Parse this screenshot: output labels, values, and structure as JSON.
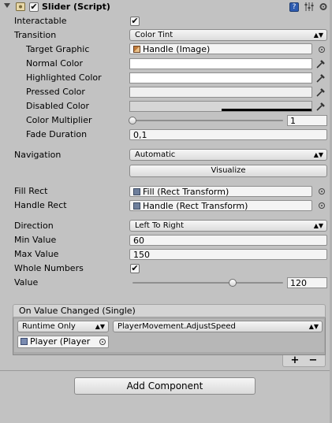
{
  "header": {
    "component_title": "Slider (Script)",
    "enabled": true
  },
  "props": {
    "interactable": {
      "label": "Interactable",
      "checked": true
    },
    "transition": {
      "label": "Transition",
      "value": "Color Tint"
    },
    "target_graphic": {
      "label": "Target Graphic",
      "value": "Handle (Image)"
    },
    "normal_color": {
      "label": "Normal Color",
      "color": "#ffffff"
    },
    "highlighted_color": {
      "label": "Highlighted Color",
      "color": "#ffffff"
    },
    "pressed_color": {
      "label": "Pressed Color",
      "color": "#c8c8c8"
    },
    "disabled_color": {
      "label": "Disabled Color",
      "color": "#c8c8c8"
    },
    "color_multiplier": {
      "label": "Color Multiplier",
      "value": "1",
      "fraction": 0.0
    },
    "fade_duration": {
      "label": "Fade Duration",
      "value": "0,1"
    },
    "navigation": {
      "label": "Navigation",
      "value": "Automatic",
      "visualize": "Visualize"
    },
    "fill_rect": {
      "label": "Fill Rect",
      "value": "Fill (Rect Transform)"
    },
    "handle_rect": {
      "label": "Handle Rect",
      "value": "Handle (Rect Transform)"
    },
    "direction": {
      "label": "Direction",
      "value": "Left To Right"
    },
    "min_value": {
      "label": "Min Value",
      "value": "60"
    },
    "max_value": {
      "label": "Max Value",
      "value": "150"
    },
    "whole_numbers": {
      "label": "Whole Numbers",
      "checked": true
    },
    "value": {
      "label": "Value",
      "value": "120",
      "fraction": 0.6667
    }
  },
  "event": {
    "title": "On Value Changed (Single)",
    "runtime": "Runtime Only",
    "function": "PlayerMovement.AdjustSpeed",
    "object": "Player (Player",
    "add": "+",
    "remove": "−"
  },
  "add_component": "Add Component"
}
